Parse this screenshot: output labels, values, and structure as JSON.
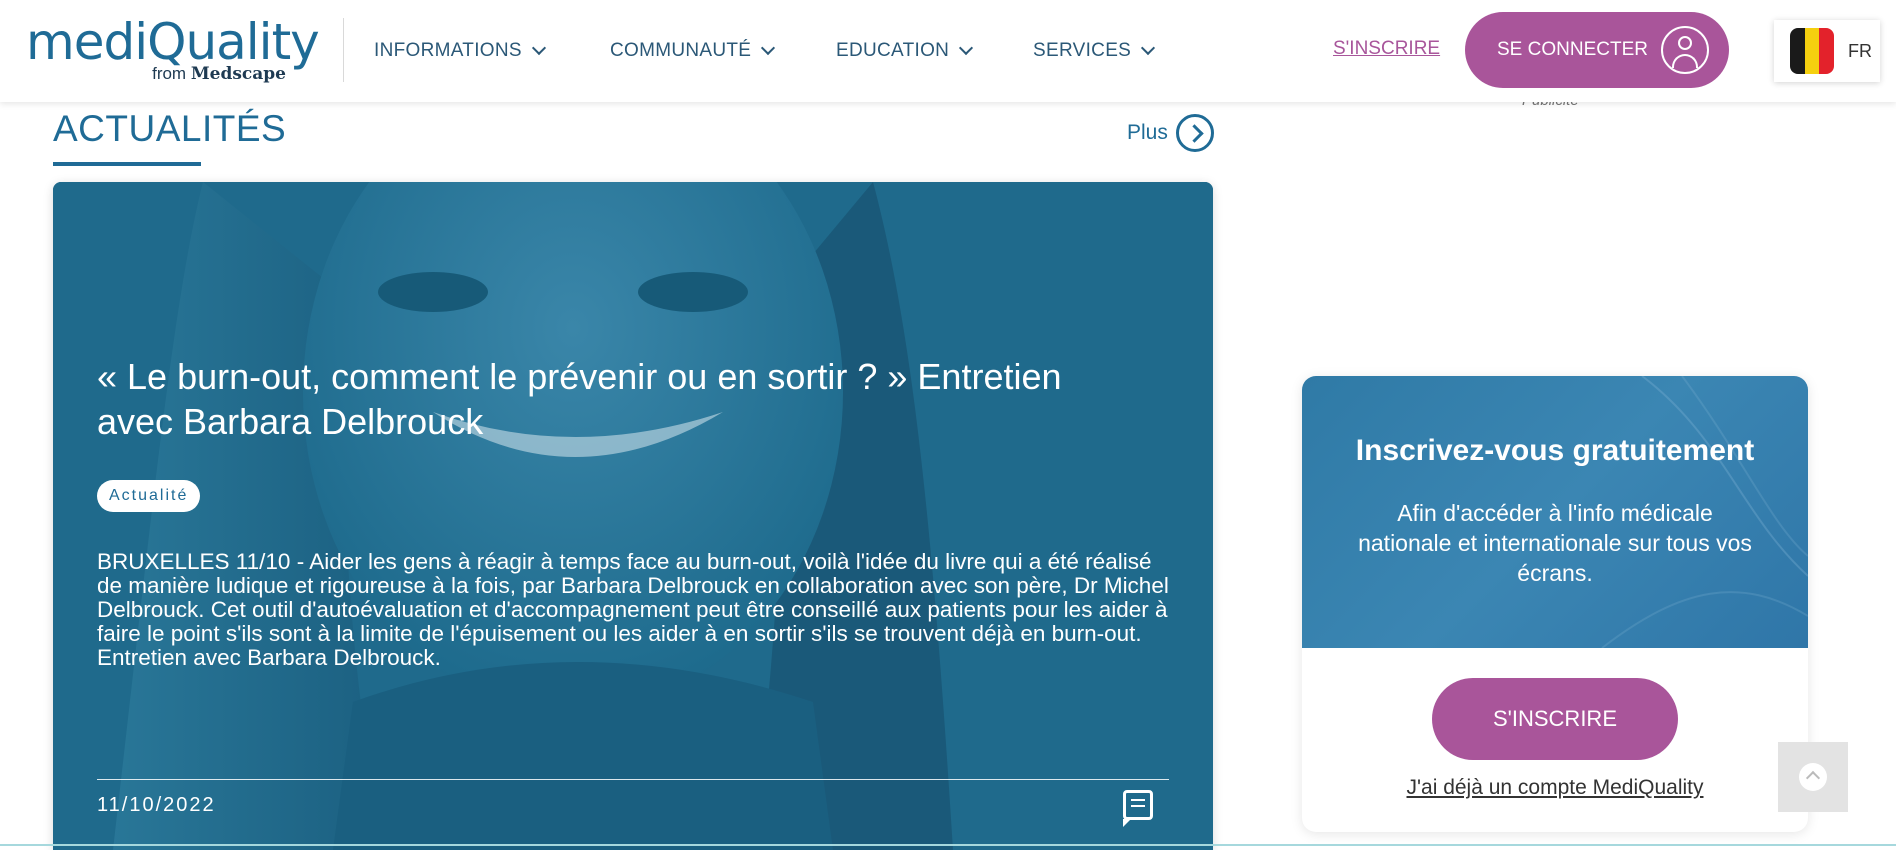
{
  "header": {
    "logo_text": "mediQuality",
    "logo_sub_prefix": "from",
    "logo_sub_brand": "Medscape",
    "nav": [
      {
        "label": "INFORMATIONS"
      },
      {
        "label": "COMMUNAUTÉ"
      },
      {
        "label": "EDUCATION"
      },
      {
        "label": "SERVICES"
      }
    ],
    "signup_link": "S'INSCRIRE",
    "login_button": "SE CONNECTER",
    "language": "FR",
    "flag_colors": [
      "#1a1a1a",
      "#f5d00f",
      "#e3222b"
    ]
  },
  "section": {
    "title": "ACTUALITÉS",
    "more": "Plus"
  },
  "article": {
    "title": "« Le burn-out, comment le prévenir ou en sortir ? » Entretien avec Barbara Delbrouck",
    "tag": "Actualité",
    "excerpt": "BRUXELLES 11/10 - Aider les gens à réagir à temps face au burn-out, voilà l'idée du livre qui a été réalisé de manière ludique et rigoureuse à la fois, par Barbara Delbrouck en collaboration avec son père, Dr Michel Delbrouck. Cet outil d'autoévaluation et d'accompagnement peut être conseillé aux patients pour les aider à faire le point s'ils sont à la limite de l'épuisement ou les aider à en sortir s'ils se trouvent déjà en burn-out. Entretien avec Barbara Delbrouck.",
    "date": "11/10/2022"
  },
  "sidebar": {
    "ad_label": "Publicité",
    "signup_title": "Inscrivez-vous gratuitement",
    "signup_text": "Afin d'accéder à l'info médicale nationale et internationale sur tous vos écrans.",
    "signup_button": "S'INSCRIRE",
    "account_link": "J'ai déjà un compte MediQuality"
  },
  "colors": {
    "brand_blue": "#1f6b96",
    "accent_purple": "#a9559a",
    "card_overlay": "#1e6a8c"
  }
}
